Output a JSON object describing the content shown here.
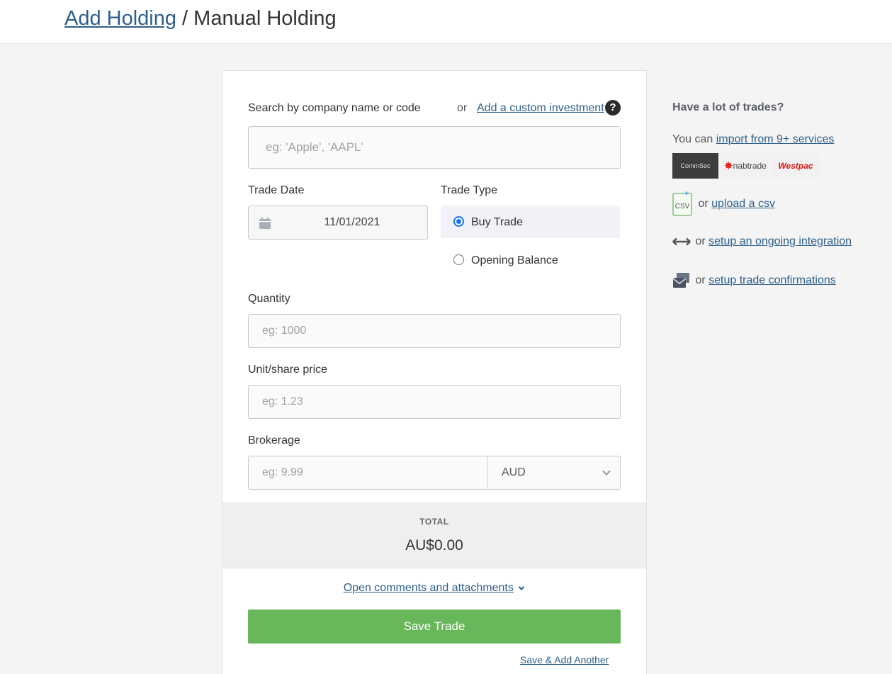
{
  "header": {
    "breadcrumb_link": "Add Holding",
    "separator": " / ",
    "current": "Manual Holding"
  },
  "form": {
    "search_label": "Search by company name or code",
    "or_text": "or",
    "custom_investment_link": "Add a custom investment",
    "help_icon": "?",
    "search_placeholder": "eg: 'Apple', 'AAPL'",
    "trade_date_label": "Trade Date",
    "trade_date_value": "11/01/2021",
    "trade_type_label": "Trade Type",
    "trade_types": [
      {
        "label": "Buy Trade",
        "selected": true
      },
      {
        "label": "Opening Balance",
        "selected": false
      }
    ],
    "quantity_label": "Quantity",
    "quantity_placeholder": "eg: 1000",
    "price_label": "Unit/share price",
    "price_placeholder": "eg: 1.23",
    "brokerage_label": "Brokerage",
    "brokerage_placeholder": "eg: 9.99",
    "currency_value": "AUD",
    "total_label": "TOTAL",
    "total_value": "AU$0.00",
    "comments_link": "Open comments and attachments",
    "save_button": "Save Trade",
    "save_another_link": "Save & Add Another"
  },
  "sidebar": {
    "heading": "Have a lot of trades?",
    "import_prefix": "You can ",
    "import_link": "import from 9+ services",
    "logos": [
      "CommSec",
      "nabtrade",
      "Westpac"
    ],
    "csv_prefix": "or ",
    "csv_link": "upload a csv",
    "csv_icon_text": "CSV",
    "integration_prefix": "or ",
    "integration_link": "setup an ongoing integration",
    "confirmations_prefix": "or ",
    "confirmations_link": "setup trade confirmations"
  },
  "colors": {
    "link": "#2d5f8a",
    "save_button": "#68b75a",
    "radio_selected": "#1a73e8",
    "total_background": "#efefef"
  },
  "icons": [
    "calendar-icon",
    "chevron-down-icon",
    "help-icon",
    "csv-file-icon",
    "integration-arrows-icon",
    "trade-confirmation-icon"
  ]
}
